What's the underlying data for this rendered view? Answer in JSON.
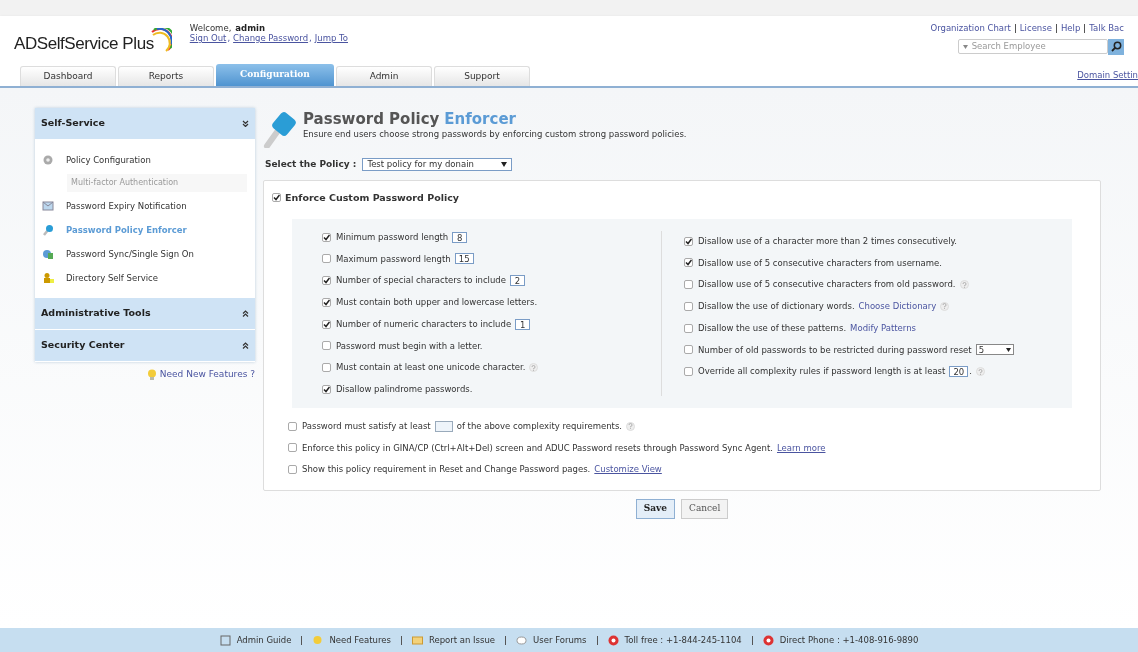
{
  "header": {
    "logo": "ADSelfService Plus",
    "welcome": "Welcome,",
    "user": "admin",
    "user_links": [
      "Sign Out",
      "Change Password",
      "Jump To"
    ],
    "link_separator": ",",
    "top_links": [
      "Organization Chart",
      "License",
      "Help",
      "Talk Bac"
    ],
    "search": {
      "placeholder": "Search Employee"
    },
    "domain_link": "Domain Settin"
  },
  "tabs": [
    {
      "label": "Dashboard",
      "selected": false
    },
    {
      "label": "Reports",
      "selected": false
    },
    {
      "label": "Configuration",
      "selected": true
    },
    {
      "label": "Admin",
      "selected": false
    },
    {
      "label": "Support",
      "selected": false
    }
  ],
  "sidebar": {
    "sections": [
      {
        "title": "Self-Service",
        "expanded": true,
        "items": [
          {
            "label": "Policy Configuration",
            "selected": false,
            "children": [
              {
                "label": "Multi-factor Authentication"
              }
            ]
          },
          {
            "label": "Password Expiry Notification",
            "selected": false
          },
          {
            "label": "Password Policy Enforcer",
            "selected": true
          },
          {
            "label": "Password Sync/Single Sign On",
            "selected": false
          },
          {
            "label": "Directory Self Service",
            "selected": false
          }
        ]
      },
      {
        "title": "Administrative Tools",
        "expanded": false
      },
      {
        "title": "Security Center",
        "expanded": false
      }
    ],
    "feature_link": "Need New Features ?"
  },
  "page": {
    "title": "Password Policy",
    "title_highlight": "Enforcer",
    "subtitle": "Ensure end users choose strong passwords by enforcing custom strong password policies.",
    "policy_label": "Select the Policy :",
    "policy_value": "Test policy for my donain",
    "enforce": {
      "label": "Enforce Custom Password Policy",
      "checked": true
    },
    "left_options": [
      {
        "kind": "number",
        "label": "Minimum password length",
        "value": "8",
        "checked": true
      },
      {
        "kind": "number",
        "label": "Maximum password length",
        "value": "15",
        "checked": false
      },
      {
        "kind": "number",
        "label": "Number of special characters to include",
        "value": "2",
        "checked": true
      },
      {
        "kind": "plain",
        "label": "Must contain both upper and lowercase letters.",
        "checked": true
      },
      {
        "kind": "number",
        "label": "Number of numeric characters to include",
        "value": "1",
        "checked": true
      },
      {
        "kind": "plain",
        "label": "Password must begin with a letter.",
        "checked": false
      },
      {
        "kind": "plain",
        "label": "Must contain at least one unicode character.",
        "checked": false,
        "help": true
      },
      {
        "kind": "plain",
        "label": "Disallow palindrome passwords.",
        "checked": true
      }
    ],
    "right_options": [
      {
        "kind": "plain",
        "label": "Disallow use of a character more than 2 times consecutively.",
        "checked": true
      },
      {
        "kind": "plain",
        "label": "Disallow use of 5 consecutive characters from username.",
        "checked": true
      },
      {
        "kind": "plain",
        "label": "Disallow use of 5 consecutive characters from old password.",
        "checked": false,
        "help": true
      },
      {
        "kind": "plain",
        "label": "Disallow the use of dictionary words.",
        "link": "Choose Dictionary",
        "checked": false,
        "help": true
      },
      {
        "kind": "plain",
        "label": "Disallow the use of these patterns.",
        "link": "Modify Patterns",
        "checked": false
      },
      {
        "kind": "select",
        "label": "Number of old passwords to be restricted during password reset",
        "value": "5",
        "checked": false
      },
      {
        "kind": "number",
        "label": "Override all complexity rules if password length is at least",
        "value": "20",
        "suffix": ".",
        "checked": false,
        "help": true
      }
    ],
    "bottom_options": [
      {
        "kind": "blank-field",
        "label": "Password must satisfy at least",
        "suffix": "of the above complexity requirements.",
        "checked": false,
        "help": true
      },
      {
        "kind": "plain",
        "label": "Enforce this policy in GINA/CP (Ctrl+Alt+Del) screen and ADUC Password resets through Password Sync Agent.",
        "link": "Learn more",
        "underline": true,
        "checked": false
      },
      {
        "kind": "plain",
        "label": "Show this policy requirement in Reset and Change Password pages.",
        "link": "Customize View",
        "underline": true,
        "checked": false
      }
    ],
    "buttons": [
      "Save",
      "Cancel"
    ]
  },
  "footer": [
    {
      "label": "Admin Guide"
    },
    {
      "label": "Need Features"
    },
    {
      "label": "Report an Issue"
    },
    {
      "label": "User Forums"
    },
    {
      "label": "Toll free : +1-844-245-1104"
    },
    {
      "label": "Direct Phone : +1-408-916-9890"
    }
  ]
}
